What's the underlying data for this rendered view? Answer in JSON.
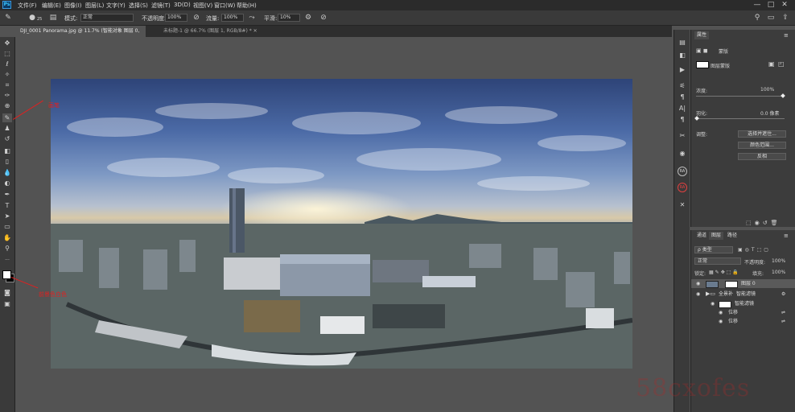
{
  "menubar": {
    "logo": "Ps",
    "menus": [
      "文件(F)",
      "编辑(E)",
      "图像(I)",
      "图层(L)",
      "文字(Y)",
      "选择(S)",
      "滤镜(T)",
      "3D(D)",
      "视图(V)",
      "窗口(W)",
      "帮助(H)"
    ],
    "window_controls": [
      "—",
      "□",
      "✕"
    ]
  },
  "options": {
    "size_value": "25",
    "mode_label": "模式:",
    "mode_value": "正常",
    "opacity_label": "不透明度:",
    "opacity_value": "100%",
    "flow_label": "流量:",
    "flow_value": "100%",
    "smooth_label": "平滑:",
    "smooth_value": "10%"
  },
  "tabs": [
    {
      "label": "DJI_0001 Panorama.jpg @ 11.7% (智能对象 图层 0, RGB/8) * ✕",
      "active": true
    },
    {
      "label": "未标题-1 @ 66.7% (图层 1, RGB/8#) * ✕",
      "active": false
    }
  ],
  "toolbar": {
    "tools": [
      "move-tool-icon",
      "marquee-tool-icon",
      "lasso-tool-icon",
      "quick-select-tool-icon",
      "crop-tool-icon",
      "eyedropper-tool-icon",
      "spot-heal-tool-icon",
      "brush-tool-icon",
      "clone-stamp-tool-icon",
      "history-brush-tool-icon",
      "eraser-tool-icon",
      "gradient-tool-icon",
      "blur-tool-icon",
      "dodge-tool-icon",
      "pen-tool-icon",
      "type-tool-icon",
      "path-select-tool-icon",
      "rectangle-tool-icon",
      "hand-tool-icon",
      "zoom-tool-icon"
    ]
  },
  "annotations": {
    "brush": "画笔",
    "color": "前景色白色"
  },
  "properties": {
    "tab_label": "属性",
    "mask_type": "蒙版",
    "mask_name": "图层蒙版",
    "density_label": "浓度:",
    "density_value": "100%",
    "feather_label": "羽化:",
    "feather_value": "0.0 像素",
    "adjust_label": "调整:",
    "btn_select_mask": "选择并遮住...",
    "btn_color_range": "颜色范围...",
    "btn_invert": "反相"
  },
  "layers": {
    "tabs": [
      "通道",
      "图层",
      "路径"
    ],
    "filter_kind": "ρ 类型",
    "blend_mode": "正常",
    "opacity_label": "不透明度:",
    "opacity_value": "100%",
    "lock_label": "锁定:",
    "fill_label": "填充:",
    "fill_value": "100%",
    "rows": [
      {
        "name": "图层 0",
        "sub": false
      },
      {
        "name": "智能滤镜",
        "sub": false,
        "prefix": "全景补"
      },
      {
        "name": "智能滤镜",
        "sub": true
      },
      {
        "name": "位移",
        "sub": true
      },
      {
        "name": "位移",
        "sub": true
      }
    ]
  },
  "watermark": "58cxofes"
}
